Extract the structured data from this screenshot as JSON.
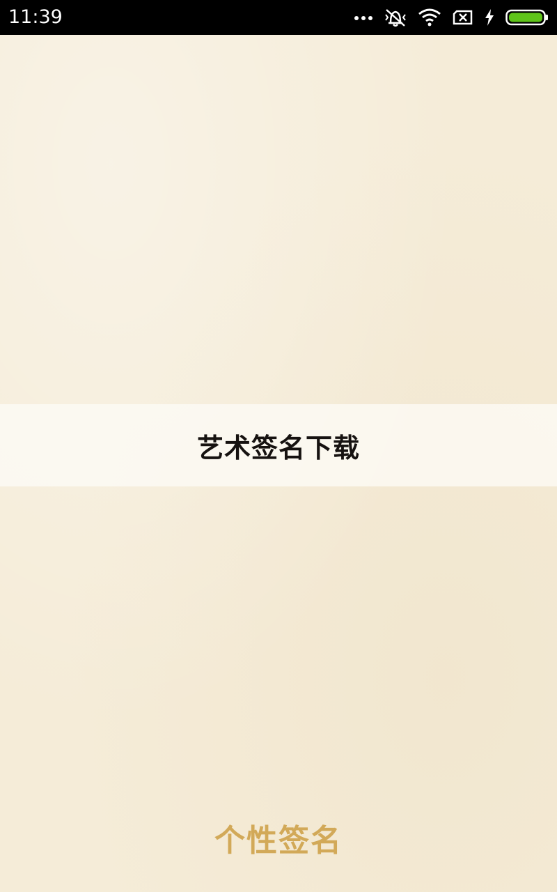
{
  "status_bar": {
    "time": "11:39",
    "icons": [
      "more-dots-icon",
      "vibrate-off-icon",
      "wifi-icon",
      "no-sim-icon",
      "charging-icon",
      "battery-icon"
    ],
    "battery_color": "#5fc41a"
  },
  "main": {
    "banner_title": "艺术签名下载",
    "footer_title": "个性签名"
  },
  "colors": {
    "background": "#f5ecd8",
    "banner_text": "#161210",
    "footer_text": "#d2a958"
  }
}
